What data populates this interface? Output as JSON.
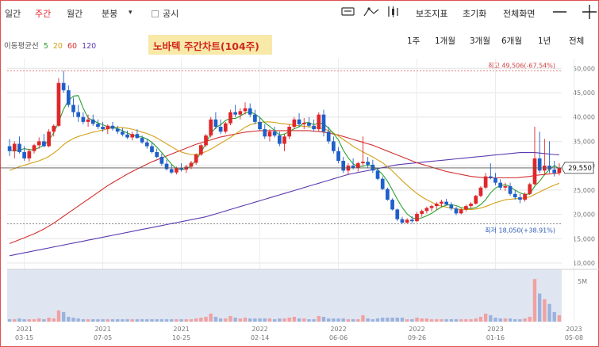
{
  "toolbar": {
    "tabs": [
      {
        "label": "일간",
        "active": false
      },
      {
        "label": "주간",
        "active": true
      },
      {
        "label": "월간",
        "active": false
      },
      {
        "label": "분봉",
        "active": false
      }
    ],
    "dropdown_glyph": "▾",
    "disclosure_label": "공시",
    "right_labels": {
      "aux": "보조지표",
      "reset": "초기화",
      "fullscreen": "전체화면"
    },
    "icons": {
      "draw": "pencil-icon",
      "line": "trendline-icon",
      "bars": "candle-mode-icon",
      "minus": "minus-icon",
      "plus": "plus-icon"
    }
  },
  "ma_legend": {
    "label": "이동평균선",
    "periods": [
      {
        "label": "5",
        "color": "#2ca02c"
      },
      {
        "label": "20",
        "color": "#d4a017"
      },
      {
        "label": "60",
        "color": "#d32f2f"
      },
      {
        "label": "120",
        "color": "#5c3bb0"
      }
    ]
  },
  "title": "노바텍 주간차트(104주)",
  "ranges": [
    "1주",
    "1개월",
    "3개월",
    "6개월",
    "1년",
    "전체"
  ],
  "chart_data": {
    "type": "candlestick",
    "title": "노바텍 주간차트(104주)",
    "y_ticks": [
      10000,
      15000,
      20000,
      25000,
      30000,
      35000,
      40000,
      45000,
      50000
    ],
    "y_tick_labels": [
      "10,000",
      "15,000",
      "20,000",
      "25,000",
      "30,000",
      "35,000",
      "40,000",
      "45,000",
      "50,000"
    ],
    "ylim": [
      10000,
      52000
    ],
    "x_ticks": [
      {
        "year": "2021",
        "date": "03-15",
        "index": 3
      },
      {
        "year": "2021",
        "date": "07-05",
        "index": 19
      },
      {
        "year": "2021",
        "date": "10-25",
        "index": 35
      },
      {
        "year": "2022",
        "date": "02-14",
        "index": 51
      },
      {
        "year": "2022",
        "date": "06-06",
        "index": 67
      },
      {
        "year": "2022",
        "date": "09-26",
        "index": 83
      },
      {
        "year": "2023",
        "date": "01-16",
        "index": 99
      },
      {
        "year": "2023",
        "date": "05-08",
        "index": 115
      }
    ],
    "high": {
      "value": 49506,
      "label": "최고 49,506(-67.54%)"
    },
    "low": {
      "value": 18050,
      "label": "최저 18,050(+38.91%)"
    },
    "current": {
      "value": 29550,
      "label": "29,550"
    },
    "volume_ticks": [
      "5M"
    ],
    "candles": [
      [
        34000,
        35500,
        32000,
        33000
      ],
      [
        33000,
        35000,
        31500,
        34500
      ],
      [
        34500,
        36000,
        32500,
        32800
      ],
      [
        32800,
        34000,
        31000,
        31500
      ],
      [
        31500,
        33500,
        30800,
        33000
      ],
      [
        33000,
        34500,
        32500,
        34200
      ],
      [
        34200,
        35800,
        33500,
        35000
      ],
      [
        35000,
        36500,
        33800,
        34000
      ],
      [
        34000,
        37500,
        33800,
        37000
      ],
      [
        37000,
        38500,
        36000,
        38200
      ],
      [
        38200,
        48000,
        38000,
        47000
      ],
      [
        47000,
        49506,
        45000,
        45500
      ],
      [
        45500,
        46500,
        42000,
        42500
      ],
      [
        42500,
        44000,
        40000,
        41000
      ],
      [
        41000,
        42500,
        39000,
        40000
      ],
      [
        40000,
        41000,
        38500,
        39000
      ],
      [
        39000,
        40500,
        38000,
        39500
      ],
      [
        39500,
        40500,
        38200,
        38600
      ],
      [
        38600,
        39500,
        37500,
        38000
      ],
      [
        38000,
        39000,
        37000,
        37500
      ],
      [
        37500,
        38500,
        36500,
        38200
      ],
      [
        38200,
        39000,
        37200,
        37600
      ],
      [
        37600,
        38200,
        36500,
        37000
      ],
      [
        37000,
        37800,
        36000,
        36400
      ],
      [
        36400,
        37200,
        35500,
        35800
      ],
      [
        35800,
        37000,
        35200,
        36500
      ],
      [
        36500,
        37500,
        35500,
        35700
      ],
      [
        35700,
        36200,
        34500,
        34800
      ],
      [
        34800,
        35500,
        33500,
        34000
      ],
      [
        34000,
        34800,
        32500,
        32800
      ],
      [
        32800,
        33500,
        31500,
        31800
      ],
      [
        31800,
        32500,
        30000,
        30400
      ],
      [
        30400,
        31200,
        29000,
        29300
      ],
      [
        29300,
        30200,
        28300,
        28600
      ],
      [
        28600,
        29800,
        28200,
        29500
      ],
      [
        29500,
        30500,
        28800,
        29200
      ],
      [
        29200,
        30200,
        28500,
        29800
      ],
      [
        29800,
        31000,
        29300,
        30600
      ],
      [
        30600,
        32500,
        30200,
        32300
      ],
      [
        32300,
        34500,
        32000,
        34200
      ],
      [
        34200,
        36500,
        33800,
        36200
      ],
      [
        36200,
        40000,
        35800,
        39500
      ],
      [
        39500,
        41000,
        37500,
        38000
      ],
      [
        38000,
        39500,
        36500,
        37000
      ],
      [
        37000,
        39000,
        36600,
        38700
      ],
      [
        38700,
        41500,
        38300,
        41000
      ],
      [
        41000,
        42500,
        40000,
        40500
      ],
      [
        40500,
        41800,
        39500,
        41200
      ],
      [
        41200,
        43000,
        40500,
        41800
      ],
      [
        41800,
        42800,
        40000,
        40500
      ],
      [
        40500,
        41500,
        38500,
        39000
      ],
      [
        39000,
        40000,
        37200,
        37500
      ],
      [
        37500,
        38500,
        35500,
        36000
      ],
      [
        36000,
        37500,
        35000,
        37000
      ],
      [
        37000,
        38000,
        35800,
        36200
      ],
      [
        36200,
        37000,
        34000,
        34500
      ],
      [
        34500,
        36500,
        33000,
        36000
      ],
      [
        36000,
        38500,
        35500,
        38000
      ],
      [
        38000,
        40000,
        37500,
        39500
      ],
      [
        39500,
        40800,
        38000,
        38500
      ],
      [
        38500,
        39800,
        37500,
        38800
      ],
      [
        38800,
        40000,
        37800,
        38200
      ],
      [
        38200,
        39500,
        37000,
        37500
      ],
      [
        37500,
        41000,
        37000,
        40500
      ],
      [
        40500,
        41500,
        36000,
        37000
      ],
      [
        37000,
        38000,
        34500,
        35000
      ],
      [
        35000,
        36000,
        32500,
        33000
      ],
      [
        33000,
        33800,
        30500,
        31000
      ],
      [
        31000,
        31800,
        28500,
        29000
      ],
      [
        29000,
        30500,
        28200,
        30000
      ],
      [
        30000,
        31500,
        29200,
        29600
      ],
      [
        29600,
        30800,
        28800,
        30500
      ],
      [
        30500,
        36000,
        30000,
        30800
      ],
      [
        30800,
        31800,
        29500,
        30200
      ],
      [
        30200,
        31200,
        28500,
        29000
      ],
      [
        29000,
        29500,
        27000,
        27300
      ],
      [
        27300,
        27800,
        25000,
        25200
      ],
      [
        25200,
        25500,
        22800,
        23000
      ],
      [
        23000,
        23300,
        20800,
        21000
      ],
      [
        21000,
        21200,
        18600,
        19000
      ],
      [
        19000,
        19500,
        18050,
        18300
      ],
      [
        18300,
        19200,
        18100,
        18900
      ],
      [
        18900,
        19600,
        18200,
        18600
      ],
      [
        18600,
        20500,
        18400,
        20100
      ],
      [
        20100,
        21000,
        19500,
        20700
      ],
      [
        20700,
        21600,
        20200,
        21300
      ],
      [
        21300,
        22000,
        20600,
        21700
      ],
      [
        21700,
        22500,
        21000,
        22200
      ],
      [
        22200,
        23000,
        21500,
        22600
      ],
      [
        22600,
        23200,
        21800,
        22000
      ],
      [
        22000,
        22500,
        20800,
        21200
      ],
      [
        21200,
        21600,
        19800,
        20200
      ],
      [
        20200,
        21300,
        20000,
        21000
      ],
      [
        21000,
        22000,
        20600,
        21700
      ],
      [
        21700,
        22500,
        21200,
        22200
      ],
      [
        22200,
        24000,
        22000,
        23800
      ],
      [
        23800,
        25800,
        23500,
        25500
      ],
      [
        25500,
        28500,
        25200,
        27800
      ],
      [
        27800,
        30500,
        27200,
        27500
      ],
      [
        27500,
        28500,
        26000,
        26500
      ],
      [
        26500,
        27200,
        25000,
        25500
      ],
      [
        25500,
        26500,
        24800,
        25800
      ],
      [
        25800,
        26500,
        23800,
        24200
      ],
      [
        24200,
        25000,
        23000,
        23500
      ],
      [
        23500,
        24200,
        22300,
        23000
      ],
      [
        23000,
        24500,
        22600,
        24200
      ],
      [
        24200,
        26500,
        24000,
        26200
      ],
      [
        26200,
        38000,
        26000,
        31500
      ],
      [
        31500,
        37000,
        28500,
        29000
      ],
      [
        29000,
        35500,
        28000,
        30000
      ],
      [
        30000,
        35000,
        28500,
        29200
      ],
      [
        29200,
        31000,
        27800,
        28500
      ],
      [
        28500,
        30500,
        28000,
        29550
      ]
    ],
    "volume": [
      0.3,
      0.3,
      0.4,
      0.3,
      0.3,
      0.3,
      0.4,
      0.3,
      0.5,
      0.4,
      1.4,
      1.2,
      0.6,
      0.5,
      0.4,
      0.3,
      0.3,
      0.3,
      0.3,
      0.3,
      0.3,
      0.3,
      0.3,
      0.3,
      0.3,
      0.3,
      0.3,
      0.3,
      0.3,
      0.3,
      0.3,
      0.3,
      0.3,
      0.3,
      0.3,
      0.3,
      0.3,
      0.3,
      0.4,
      0.5,
      0.6,
      1.0,
      0.6,
      0.4,
      0.4,
      0.7,
      0.5,
      0.4,
      0.5,
      0.4,
      0.4,
      0.4,
      0.4,
      0.4,
      0.3,
      0.4,
      0.4,
      0.5,
      0.6,
      0.4,
      0.4,
      0.3,
      0.3,
      0.7,
      0.6,
      0.4,
      0.4,
      0.4,
      0.4,
      0.3,
      0.3,
      0.3,
      0.8,
      0.4,
      0.3,
      0.4,
      0.5,
      0.5,
      0.5,
      0.5,
      0.5,
      0.3,
      0.3,
      0.5,
      0.4,
      0.4,
      0.3,
      0.3,
      0.3,
      0.3,
      0.3,
      0.3,
      0.3,
      0.3,
      0.3,
      0.4,
      0.6,
      1.0,
      0.8,
      0.5,
      0.4,
      0.4,
      0.4,
      0.3,
      0.3,
      0.4,
      0.6,
      5.3,
      3.5,
      2.8,
      2.2,
      1.2,
      0.8
    ],
    "ma": {
      "5": [
        33200,
        33000,
        33200,
        33500,
        33300,
        33300,
        33700,
        34200,
        35200,
        36800,
        39000,
        41600,
        43400,
        44300,
        44400,
        41800,
        39800,
        39300,
        38800,
        38400,
        38000,
        37900,
        37600,
        37200,
        36700,
        36300,
        36000,
        35900,
        35500,
        34800,
        33800,
        32700,
        31500,
        30300,
        29400,
        29200,
        29300,
        30000,
        31200,
        32700,
        34600,
        36600,
        37800,
        38400,
        39300,
        39700,
        39700,
        40200,
        40800,
        41100,
        40600,
        39900,
        38800,
        38100,
        37200,
        36300,
        36500,
        37000,
        37600,
        38000,
        38800,
        38900,
        38400,
        38800,
        38600,
        37700,
        36600,
        35300,
        33200,
        31600,
        30400,
        29800,
        29900,
        30100,
        29900,
        29200,
        28200,
        26800,
        25000,
        23100,
        21400,
        20100,
        19300,
        19000,
        19300,
        19700,
        20200,
        20900,
        21500,
        21900,
        22000,
        21800,
        21400,
        21200,
        21200,
        21400,
        22000,
        23000,
        24400,
        25400,
        25900,
        26100,
        25700,
        25000,
        24400,
        24100,
        24200,
        25800,
        26800,
        28200,
        29200,
        30000,
        29400
      ],
      "20": [
        29000,
        29400,
        29800,
        30100,
        30400,
        30700,
        31000,
        31400,
        31900,
        32600,
        33400,
        34300,
        35000,
        35600,
        36000,
        36300,
        36600,
        36900,
        37100,
        37300,
        37600,
        37800,
        37900,
        37800,
        37700,
        37500,
        37200,
        36900,
        36600,
        36200,
        35700,
        35100,
        34500,
        33900,
        33300,
        32800,
        32500,
        32300,
        32300,
        32500,
        32900,
        33400,
        34000,
        34600,
        35200,
        35800,
        36500,
        37200,
        37900,
        38400,
        38700,
        38900,
        39000,
        39000,
        38900,
        38700,
        38600,
        38500,
        38300,
        38200,
        38100,
        38000,
        37900,
        37800,
        37600,
        37200,
        36700,
        36100,
        35400,
        34700,
        34000,
        33400,
        32800,
        32300,
        31800,
        31200,
        30600,
        29800,
        28900,
        27900,
        26900,
        26000,
        25100,
        24300,
        23600,
        23000,
        22500,
        22000,
        21700,
        21500,
        21300,
        21100,
        21000,
        21000,
        21000,
        21100,
        21300,
        21600,
        22000,
        22400,
        22700,
        23000,
        23100,
        23200,
        23300,
        23400,
        23600,
        24100,
        24600,
        25100,
        25600,
        26000,
        26400
      ],
      "60": [
        14000,
        14400,
        14800,
        15200,
        15600,
        16000,
        16500,
        17000,
        17600,
        18200,
        18900,
        19600,
        20300,
        21000,
        21700,
        22400,
        23100,
        23800,
        24500,
        25200,
        25900,
        26500,
        27100,
        27700,
        28300,
        28800,
        29300,
        29800,
        30300,
        30800,
        31200,
        31600,
        32000,
        32400,
        32800,
        33200,
        33600,
        34000,
        34400,
        34700,
        35000,
        35300,
        35600,
        35900,
        36100,
        36300,
        36500,
        36700,
        36900,
        37000,
        37100,
        37200,
        37200,
        37200,
        37200,
        37200,
        37200,
        37200,
        37200,
        37200,
        37200,
        37200,
        37100,
        37000,
        36900,
        36700,
        36500,
        36300,
        36000,
        35700,
        35400,
        35100,
        34800,
        34500,
        34200,
        33800,
        33400,
        33000,
        32600,
        32200,
        31800,
        31400,
        31000,
        30600,
        30300,
        30000,
        29700,
        29400,
        29100,
        28800,
        28600,
        28400,
        28200,
        28000,
        27800,
        27700,
        27600,
        27500,
        27500,
        27500,
        27500,
        27500,
        27500,
        27500,
        27600,
        27700,
        27800,
        28000,
        28100,
        28200,
        28300,
        28400,
        28500
      ],
      "120": [
        11500,
        11700,
        11900,
        12100,
        12300,
        12500,
        12700,
        12900,
        13100,
        13300,
        13500,
        13700,
        13900,
        14100,
        14300,
        14500,
        14700,
        14900,
        15100,
        15300,
        15500,
        15700,
        15900,
        16100,
        16300,
        16500,
        16700,
        16900,
        17100,
        17300,
        17500,
        17700,
        17900,
        18100,
        18300,
        18500,
        18700,
        18900,
        19100,
        19300,
        19500,
        19800,
        20100,
        20400,
        20700,
        21000,
        21300,
        21600,
        21900,
        22200,
        22500,
        22800,
        23100,
        23400,
        23700,
        24000,
        24300,
        24600,
        24900,
        25200,
        25500,
        25800,
        26100,
        26400,
        26700,
        27000,
        27300,
        27600,
        27900,
        28200,
        28400,
        28600,
        28800,
        29000,
        29200,
        29400,
        29600,
        29800,
        30000,
        30200,
        30300,
        30400,
        30500,
        30600,
        30700,
        30800,
        30900,
        31000,
        31100,
        31200,
        31300,
        31400,
        31500,
        31600,
        31700,
        31800,
        31900,
        32000,
        32100,
        32200,
        32300,
        32400,
        32500,
        32600,
        32700,
        32700,
        32700,
        32700,
        32600,
        32500,
        32400,
        32300,
        32200
      ]
    }
  }
}
